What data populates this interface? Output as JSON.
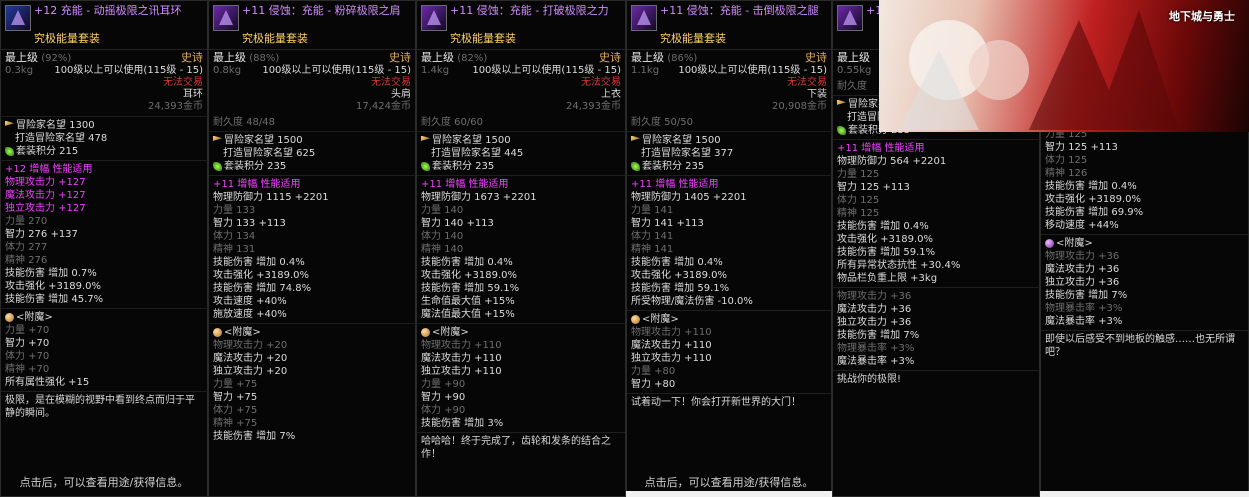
{
  "panels": [
    {
      "title": "+12 充能 - 动摇极限之讯耳环",
      "set_name": "究极能量套装",
      "level": "最上级",
      "pct": "(92%)",
      "rarity": "史诗",
      "weight": "0.3kg",
      "level_req": "100级以上可以使用(115级 - 15)",
      "trade": "无法交易",
      "slot": "耳环",
      "price": "24,393金币",
      "durability": "",
      "fame_total": "冒险家名望 1300",
      "fame_craft": "打造冒险家名望 478",
      "set_score": "套装积分 215",
      "amp_header": "+12 增幅 性能适用",
      "stats": [
        {
          "t": "物理攻击力 +127",
          "c": "magenta"
        },
        {
          "t": "魔法攻击力 +127",
          "c": "magenta"
        },
        {
          "t": "独立攻击力 +127",
          "c": "magenta"
        },
        {
          "t": "力量 270",
          "c": "gray"
        },
        {
          "t": "智力 276 +137",
          "c": "white"
        },
        {
          "t": "体力 277",
          "c": "gray"
        },
        {
          "t": "精神 276",
          "c": "gray"
        },
        {
          "t": "技能伤害 增加 0.7%",
          "c": "white"
        },
        {
          "t": "攻击强化 +3189.0%",
          "c": "white"
        },
        {
          "t": "技能伤害 增加 45.7%",
          "c": "white"
        }
      ],
      "enchant_header": "<附魔>",
      "enchant": [
        {
          "t": "力量 +70",
          "c": "gray"
        },
        {
          "t": "智力 +70",
          "c": "white"
        },
        {
          "t": "体力 +70",
          "c": "gray"
        },
        {
          "t": "精神 +70",
          "c": "gray"
        },
        {
          "t": "所有属性强化 +15",
          "c": "white"
        }
      ],
      "desc": "极限，是在模糊的视野中看到终点而归于平静的瞬间。",
      "hint": "点击后，可以查看用途/获得信息。"
    },
    {
      "title": "+11 侵蚀：充能 - 粉碎极限之肩",
      "set_name": "究极能量套装",
      "level": "最上级",
      "pct": "(88%)",
      "rarity": "史诗",
      "weight": "0.8kg",
      "level_req": "100级以上可以使用(115级 - 15)",
      "trade": "无法交易",
      "slot": "头肩",
      "price": "17,424金币",
      "durability": "耐久度 48/48",
      "fame_total": "冒险家名望 1500",
      "fame_craft": "打造冒险家名望 625",
      "set_score": "套装积分 235",
      "amp_header": "+11 增幅 性能适用",
      "stats": [
        {
          "t": "物理防御力 1115 +2201",
          "c": "white"
        },
        {
          "t": "力量 133",
          "c": "gray"
        },
        {
          "t": "智力 133 +113",
          "c": "white"
        },
        {
          "t": "体力 134",
          "c": "gray"
        },
        {
          "t": "精神 131",
          "c": "gray"
        },
        {
          "t": "技能伤害 增加 0.4%",
          "c": "white"
        },
        {
          "t": "攻击强化 +3189.0%",
          "c": "white"
        },
        {
          "t": "技能伤害 增加 74.8%",
          "c": "white"
        },
        {
          "t": "攻击速度 +40%",
          "c": "white"
        },
        {
          "t": "施放速度 +40%",
          "c": "white"
        }
      ],
      "enchant_header": "<附魔>",
      "enchant": [
        {
          "t": "物理攻击力 +20",
          "c": "gray"
        },
        {
          "t": "魔法攻击力 +20",
          "c": "white"
        },
        {
          "t": "独立攻击力 +20",
          "c": "white"
        },
        {
          "t": "力量 +75",
          "c": "gray"
        },
        {
          "t": "智力 +75",
          "c": "white"
        },
        {
          "t": "体力 +75",
          "c": "gray"
        },
        {
          "t": "精神 +75",
          "c": "gray"
        },
        {
          "t": "技能伤害 增加 7%",
          "c": "white"
        }
      ],
      "desc": "",
      "hint": ""
    },
    {
      "title": "+11 侵蚀：充能 - 打破极限之力",
      "set_name": "究极能量套装",
      "level": "最上级",
      "pct": "(82%)",
      "rarity": "史诗",
      "weight": "1.4kg",
      "level_req": "100级以上可以使用(115级 - 15)",
      "trade": "无法交易",
      "slot": "上衣",
      "price": "24,393金币",
      "durability": "耐久度 60/60",
      "fame_total": "冒险家名望 1500",
      "fame_craft": "打造冒险家名望 445",
      "set_score": "套装积分 235",
      "amp_header": "+11 增幅 性能适用",
      "stats": [
        {
          "t": "物理防御力 1673 +2201",
          "c": "white"
        },
        {
          "t": "力量 140",
          "c": "gray"
        },
        {
          "t": "智力 140 +113",
          "c": "white"
        },
        {
          "t": "体力 140",
          "c": "gray"
        },
        {
          "t": "精神 140",
          "c": "gray"
        },
        {
          "t": "技能伤害 增加 0.4%",
          "c": "white"
        },
        {
          "t": "攻击强化 +3189.0%",
          "c": "white"
        },
        {
          "t": "技能伤害 增加 59.1%",
          "c": "white"
        },
        {
          "t": "生命值最大值 +15%",
          "c": "white"
        },
        {
          "t": "魔法值最大值 +15%",
          "c": "white"
        }
      ],
      "enchant_header": "<附魔>",
      "enchant": [
        {
          "t": "物理攻击力 +110",
          "c": "gray"
        },
        {
          "t": "魔法攻击力 +110",
          "c": "white"
        },
        {
          "t": "独立攻击力 +110",
          "c": "white"
        },
        {
          "t": "力量 +90",
          "c": "gray"
        },
        {
          "t": "智力 +90",
          "c": "white"
        },
        {
          "t": "体力 +90",
          "c": "gray"
        },
        {
          "t": "技能伤害 增加 3%",
          "c": "white"
        }
      ],
      "desc": "哈哈哈！终于完成了，齿轮和发条的结合之作！",
      "hint": ""
    },
    {
      "title": "+11 侵蚀：充能 - 击倒极限之腿",
      "set_name": "究极能量套装",
      "level": "最上级",
      "pct": "(86%)",
      "rarity": "史诗",
      "weight": "1.1kg",
      "level_req": "100级以上可以使用(115级 - 15)",
      "trade": "无法交易",
      "slot": "下装",
      "price": "20,908金币",
      "durability": "耐久度 50/50",
      "fame_total": "冒险家名望 1500",
      "fame_craft": "打造冒险家名望 377",
      "set_score": "套装积分 235",
      "amp_header": "+11 增幅 性能适用",
      "stats": [
        {
          "t": "物理防御力 1405 +2201",
          "c": "white"
        },
        {
          "t": "力量 141",
          "c": "gray"
        },
        {
          "t": "智力 141 +113",
          "c": "white"
        },
        {
          "t": "体力 141",
          "c": "gray"
        },
        {
          "t": "精神 141",
          "c": "gray"
        },
        {
          "t": "技能伤害 增加 0.4%",
          "c": "white"
        },
        {
          "t": "攻击强化 +3189.0%",
          "c": "white"
        },
        {
          "t": "技能伤害 增加 59.1%",
          "c": "white"
        },
        {
          "t": "所受物理/魔法伤害 -10.0%",
          "c": "white"
        }
      ],
      "enchant_header": "<附魔>",
      "enchant": [
        {
          "t": "物理攻击力 +110",
          "c": "gray"
        },
        {
          "t": "魔法攻击力 +110",
          "c": "white"
        },
        {
          "t": "独立攻击力 +110",
          "c": "white"
        },
        {
          "t": "力量 +80",
          "c": "gray"
        },
        {
          "t": "智力 +80",
          "c": "white"
        }
      ],
      "desc": "试着动一下！你会打开新世界的大门！",
      "hint": "点击后，可以查看用途/获得信息。"
    },
    {
      "title": "+11",
      "set_name": "",
      "level": "最上级",
      "pct": "",
      "rarity": "",
      "weight": "0.55kg",
      "level_req": "1",
      "trade": "",
      "slot": "",
      "price": "",
      "durability": "耐久度",
      "fame_total": "冒险家名望 1500",
      "fame_craft": "打造冒险家名望 625",
      "set_score": "套装积分 235",
      "amp_header": "+11 增幅 性能适用",
      "stats": [
        {
          "t": "物理防御力 564 +2201",
          "c": "white"
        },
        {
          "t": "力量 125",
          "c": "gray"
        },
        {
          "t": "智力 125 +113",
          "c": "white"
        },
        {
          "t": "体力 125",
          "c": "gray"
        },
        {
          "t": "精神 125",
          "c": "gray"
        },
        {
          "t": "技能伤害 增加 0.4%",
          "c": "white"
        },
        {
          "t": "攻击强化 +3189.0%",
          "c": "white"
        },
        {
          "t": "技能伤害 增加 59.1%",
          "c": "white"
        },
        {
          "t": "所有异常状态抗性 +30.4%",
          "c": "white"
        },
        {
          "t": "物品栏负重上限 +3kg",
          "c": "white"
        }
      ],
      "enchant_header": "",
      "enchant": [
        {
          "t": "物理攻击力 +36",
          "c": "gray"
        },
        {
          "t": "魔法攻击力 +36",
          "c": "white"
        },
        {
          "t": "独立攻击力 +36",
          "c": "white"
        },
        {
          "t": "技能伤害 增加 7%",
          "c": "white"
        },
        {
          "t": "物理暴击率 +3%",
          "c": "gray"
        },
        {
          "t": "魔法暴击率 +3%",
          "c": "white"
        }
      ],
      "desc": "挑战你的极限!",
      "hint": ""
    },
    {
      "title": "",
      "set_name": "",
      "level": "",
      "pct": "",
      "rarity": "",
      "weight": "",
      "level_req": "",
      "trade": "",
      "slot": "",
      "price": "",
      "durability": "",
      "fame_total": "冒险家名望 1500",
      "fame_craft": "打造冒险家名望 625",
      "set_score": "套装积分 265",
      "amp_header": "+11 增幅 性能适用",
      "stats": [
        {
          "t": "物理防御力 860 +2201",
          "c": "white"
        },
        {
          "t": "力量 125",
          "c": "gray"
        },
        {
          "t": "智力 125 +113",
          "c": "white"
        },
        {
          "t": "体力 125",
          "c": "gray"
        },
        {
          "t": "精神 126",
          "c": "gray"
        },
        {
          "t": "技能伤害 增加 0.4%",
          "c": "white"
        },
        {
          "t": "攻击强化 +3189.0%",
          "c": "white"
        },
        {
          "t": "技能伤害 增加 69.9%",
          "c": "white"
        },
        {
          "t": "移动速度 +44%",
          "c": "white"
        }
      ],
      "enchant_header": "<附魔>",
      "enchant": [
        {
          "t": "物理攻击力 +36",
          "c": "gray"
        },
        {
          "t": "魔法攻击力 +36",
          "c": "white"
        },
        {
          "t": "独立攻击力 +36",
          "c": "white"
        },
        {
          "t": "技能伤害 增加 7%",
          "c": "white"
        },
        {
          "t": "物理暴击率 +3%",
          "c": "gray"
        },
        {
          "t": "魔法暴击率 +3%",
          "c": "white"
        }
      ],
      "desc": "即使以后感受不到地板的触感……也无所谓吧？",
      "hint": ""
    }
  ],
  "banner": {
    "logo": "地下城与勇士"
  },
  "colors": {
    "title_purple": "#d18cff",
    "set_gold": "#ffd066",
    "amp_magenta": "#f040ff",
    "untradable_red": "#d03a3a"
  }
}
